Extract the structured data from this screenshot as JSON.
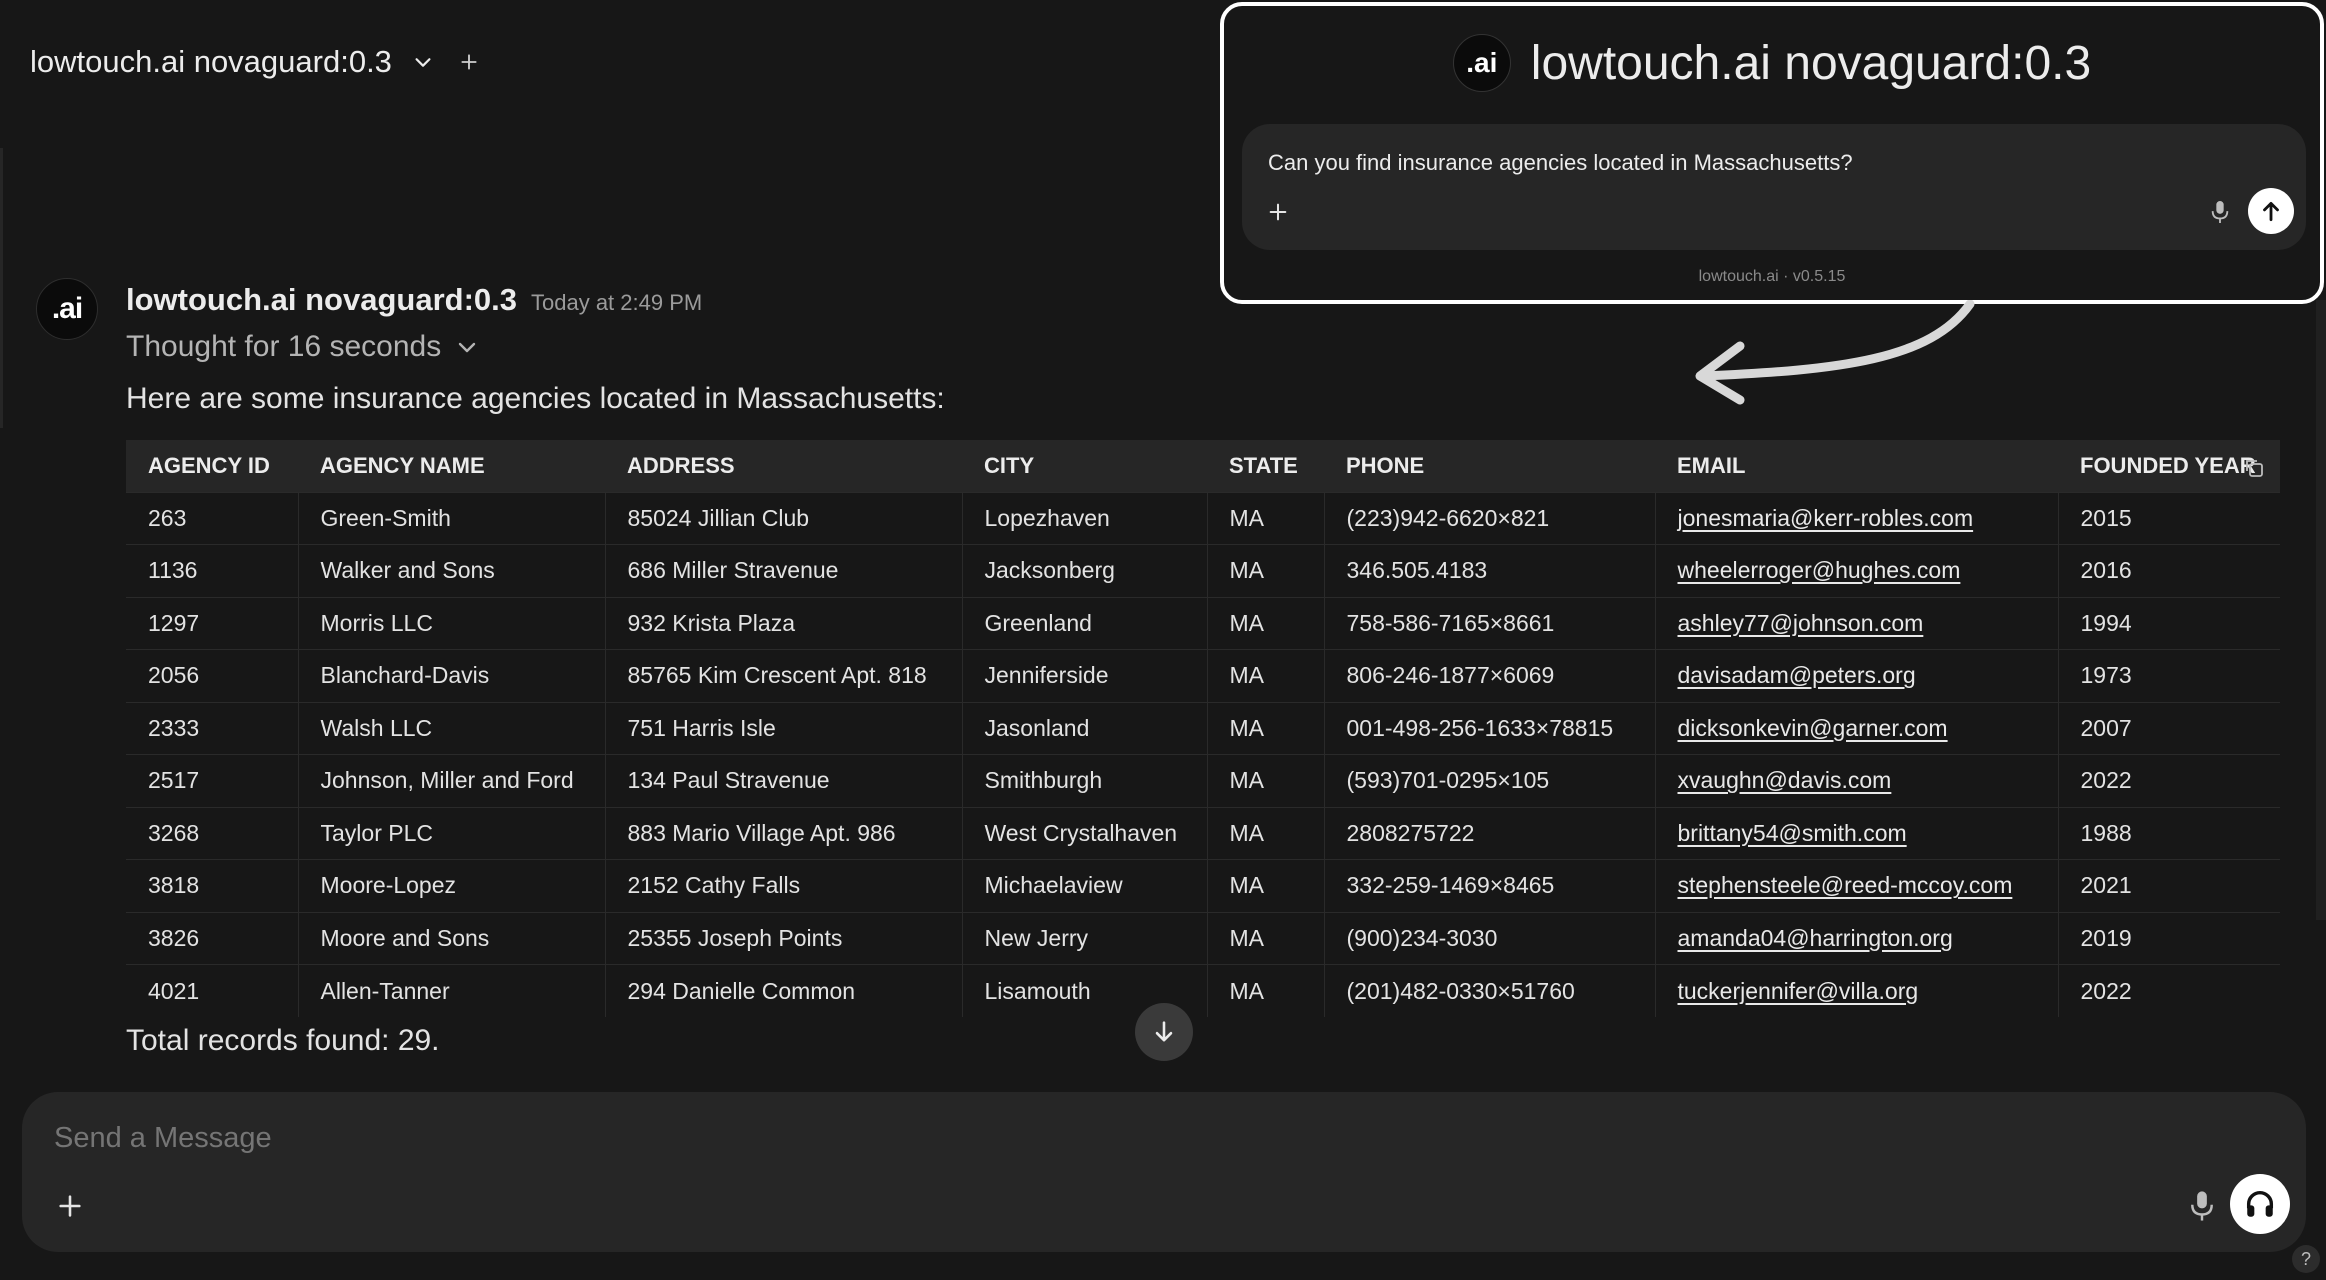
{
  "header": {
    "model_name": "lowtouch.ai novaguard:0.3"
  },
  "message": {
    "avatar_text": ".ai",
    "sender": "lowtouch.ai novaguard:0.3",
    "time": "Today at 2:49 PM",
    "thought": "Thought for 16 seconds",
    "intro": "Here are some insurance agencies located in Massachusetts:",
    "total": "Total records found: 29."
  },
  "table": {
    "headers": [
      "AGENCY ID",
      "AGENCY NAME",
      "ADDRESS",
      "CITY",
      "STATE",
      "PHONE",
      "EMAIL",
      "FOUNDED YEAR"
    ],
    "rows": [
      [
        "263",
        "Green-Smith",
        "85024 Jillian Club",
        "Lopezhaven",
        "MA",
        "(223)942-6620×821",
        "jonesmaria@kerr-robles.com",
        "2015"
      ],
      [
        "1136",
        "Walker and Sons",
        "686 Miller Stravenue",
        "Jacksonberg",
        "MA",
        "346.505.4183",
        "wheelerroger@hughes.com",
        "2016"
      ],
      [
        "1297",
        "Morris LLC",
        "932 Krista Plaza",
        "Greenland",
        "MA",
        "758-586-7165×8661",
        "ashley77@johnson.com",
        "1994"
      ],
      [
        "2056",
        "Blanchard-Davis",
        "85765 Kim Crescent Apt. 818",
        "Jenniferside",
        "MA",
        "806-246-1877×6069",
        "davisadam@peters.org",
        "1973"
      ],
      [
        "2333",
        "Walsh LLC",
        "751 Harris Isle",
        "Jasonland",
        "MA",
        "001-498-256-1633×78815",
        "dicksonkevin@garner.com",
        "2007"
      ],
      [
        "2517",
        "Johnson, Miller and Ford",
        "134 Paul Stravenue",
        "Smithburgh",
        "MA",
        "(593)701-0295×105",
        "xvaughn@davis.com",
        "2022"
      ],
      [
        "3268",
        "Taylor PLC",
        "883 Mario Village Apt. 986",
        "West Crystalhaven",
        "MA",
        "2808275722",
        "brittany54@smith.com",
        "1988"
      ],
      [
        "3818",
        "Moore-Lopez",
        "2152 Cathy Falls",
        "Michaelaview",
        "MA",
        "332-259-1469×8465",
        "stephensteele@reed-mccoy.com",
        "2021"
      ],
      [
        "3826",
        "Moore and Sons",
        "25355 Joseph Points",
        "New Jerry",
        "MA",
        "(900)234-3030",
        "amanda04@harrington.org",
        "2019"
      ],
      [
        "4021",
        "Allen-Tanner",
        "294 Danielle Common",
        "Lisamouth",
        "MA",
        "(201)482-0330×51760",
        "tuckerjennifer@villa.org",
        "2022"
      ]
    ]
  },
  "composer": {
    "placeholder": "Send a Message"
  },
  "inset": {
    "avatar_text": ".ai",
    "title": "lowtouch.ai novaguard:0.3",
    "question": "Can you find insurance agencies located in Massachusetts?",
    "version": "lowtouch.ai · v0.5.15"
  },
  "help": "?"
}
